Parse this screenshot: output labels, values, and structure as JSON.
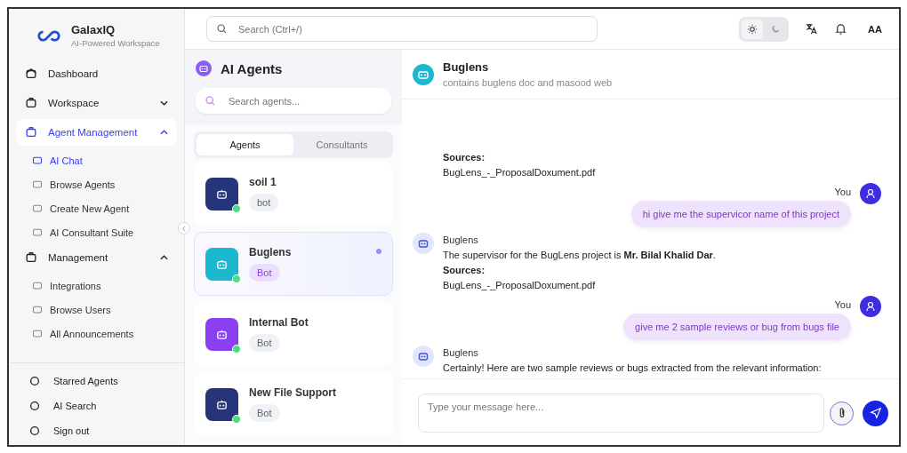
{
  "brand": {
    "name": "GalaxIQ",
    "tagline": "AI-Powered Workspace"
  },
  "nav": [
    {
      "kind": "item",
      "label": "Dashboard",
      "selected": false
    },
    {
      "kind": "group",
      "label": "Workspace",
      "selected": false,
      "expanded": false
    },
    {
      "kind": "group",
      "label": "Agent Management",
      "selected": true,
      "expanded": true,
      "children": [
        {
          "label": "AI Chat",
          "selected": true
        },
        {
          "label": "Browse Agents",
          "selected": false
        },
        {
          "label": "Create New Agent",
          "selected": false
        },
        {
          "label": "AI Consultant Suite",
          "selected": false
        }
      ]
    },
    {
      "kind": "group",
      "label": "Management",
      "selected": false,
      "expanded": true,
      "children": [
        {
          "label": "Integrations",
          "selected": false
        },
        {
          "label": "Browse Users",
          "selected": false
        },
        {
          "label": "All Announcements",
          "selected": false
        }
      ]
    }
  ],
  "bottom_nav": [
    {
      "label": "Starred Agents"
    },
    {
      "label": "AI Search"
    },
    {
      "label": "Sign out"
    }
  ],
  "topbar": {
    "search_placeholder": "Search (Ctrl+/)",
    "theme": [
      {
        "selected": true
      },
      {
        "selected": false
      }
    ],
    "avatar": "AA"
  },
  "agents_panel": {
    "title": "AI Agents",
    "search_placeholder": "Search agents...",
    "tabs": [
      {
        "label": "Agents",
        "selected": true
      },
      {
        "label": "Consultants",
        "selected": false
      }
    ],
    "agents": [
      {
        "name": "soil 1",
        "tag": "bot",
        "color": "#26357a",
        "online": true,
        "unread": false,
        "selected": false
      },
      {
        "name": "Buglens",
        "tag": "Bot",
        "color": "#1bb8d0",
        "online": true,
        "unread": true,
        "selected": true
      },
      {
        "name": "Internal Bot",
        "tag": "Bot",
        "color": "#8a3ff0",
        "online": true,
        "unread": false,
        "selected": false
      },
      {
        "name": "New File Support",
        "tag": "Bot",
        "color": "#26357a",
        "online": true,
        "unread": false,
        "selected": false
      }
    ]
  },
  "chat": {
    "name": "Buglens",
    "description": "contains buglens doc and masood web",
    "messages": [
      {
        "kind": "bot",
        "sources_label": "Sources:",
        "source": "BugLens_-_ProposalDoxument.pdf"
      },
      {
        "kind": "user",
        "sender": "You",
        "text": "hi give me the supervicor name of this project"
      },
      {
        "kind": "bot",
        "sender": "Buglens",
        "text": "The supervisor for the BugLens project is **Mr. Bilal Khalid Dar**.",
        "sources_label": "Sources:",
        "source": "BugLens_-_ProposalDoxument.pdf"
      },
      {
        "kind": "user",
        "sender": "You",
        "text": "give me 2 sample reviews or bug from bugs file"
      },
      {
        "kind": "bot",
        "sender": "Buglens",
        "text": "Certainly! Here are two sample reviews or bugs extracted from the relevant information:"
      }
    ],
    "input_placeholder": "Type your message here..."
  }
}
